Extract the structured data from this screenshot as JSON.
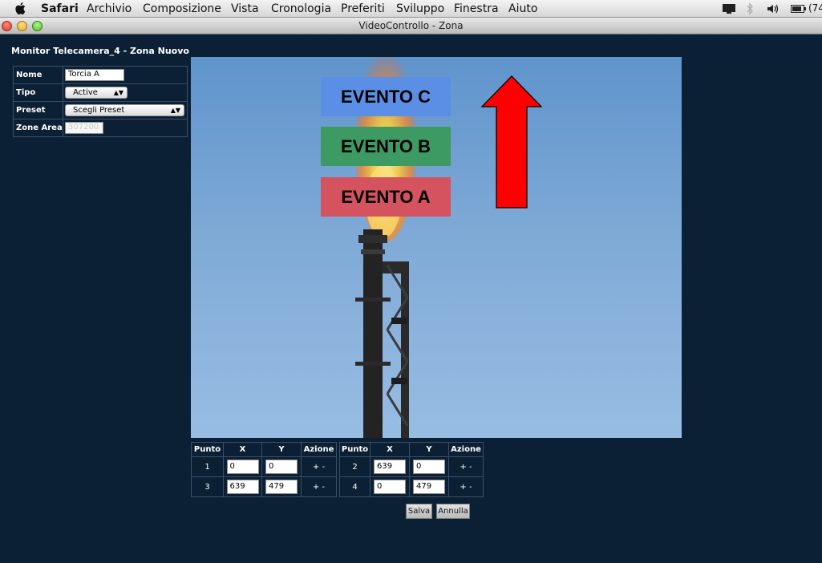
{
  "menubar": {
    "app": "Safari",
    "items": [
      "Archivio",
      "Composizione",
      "Vista",
      "Cronologia",
      "Preferiti",
      "Sviluppo",
      "Finestra",
      "Aiuto"
    ],
    "battery": "(74"
  },
  "window": {
    "title": "VideoControllo - Zona"
  },
  "page": {
    "title": "Monitor Telecamera_4 - Zona Nuovo"
  },
  "form": {
    "nome_label": "Nome",
    "nome_value": "Torcia A",
    "tipo_label": "Tipo",
    "tipo_value": "Active",
    "preset_label": "Preset",
    "preset_value": "Scegli Preset",
    "zone_label": "Zone Area",
    "zone_value": "307200"
  },
  "video": {
    "events": [
      "EVENTO C",
      "EVENTO B",
      "EVENTO A"
    ],
    "colors": {
      "event_c": "#5b8fe6",
      "event_b": "#3d9a62",
      "event_a": "#d4535f",
      "arrow": "#ff0000"
    }
  },
  "points": {
    "headers": [
      "Punto",
      "X",
      "Y",
      "Azione"
    ],
    "rows": [
      {
        "punto": "1",
        "x": "0",
        "y": "0",
        "azione": "+ -"
      },
      {
        "punto": "2",
        "x": "639",
        "y": "0",
        "azione": "+ -"
      },
      {
        "punto": "3",
        "x": "639",
        "y": "479",
        "azione": "+ -"
      },
      {
        "punto": "4",
        "x": "0",
        "y": "479",
        "azione": "+ -"
      }
    ]
  },
  "buttons": {
    "save": "Salva",
    "cancel": "Annulla"
  }
}
